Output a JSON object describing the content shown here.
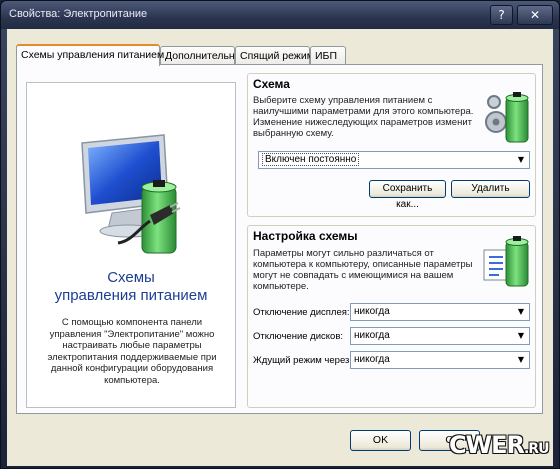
{
  "window": {
    "title": "Свойства: Электропитание",
    "help_glyph": "?",
    "close_glyph": "✕"
  },
  "tabs": [
    {
      "label": "Схемы управления питанием",
      "active": true
    },
    {
      "label": "Дополнительно",
      "active": false
    },
    {
      "label": "Спящий режим",
      "active": false
    },
    {
      "label": "ИБП",
      "active": false
    }
  ],
  "left_panel": {
    "title_line1": "Схемы",
    "title_line2": "управления питанием",
    "description": "С помощью компонента панели управления \"Электропитание\" можно настраивать любые параметры электропитания поддерживаемые при данной конфигурации оборудования компьютера."
  },
  "scheme_group": {
    "title": "Схема",
    "description": "Выберите схему управления питанием с наилучшими параметрами для этого компьютера. Изменение нижеследующих параметров изменит выбранную схему.",
    "selected_scheme": "Включен постоянно",
    "save_as_label": "Сохранить как...",
    "delete_label": "Удалить"
  },
  "settings_group": {
    "title": "Настройка схемы",
    "description": "Параметры могут сильно различаться от компьютера к компьютеру, описанные параметры могут не совпадать с имеющимися на вашем компьютере.",
    "rows": [
      {
        "label": "Отключение дисплея:",
        "value": "никогда"
      },
      {
        "label": "Отключение дисков:",
        "value": "никогда"
      },
      {
        "label": "Ждущий режим через:",
        "value": "никогда"
      }
    ]
  },
  "footer": {
    "ok_label": "OK",
    "cancel_label": "О"
  },
  "watermark": {
    "text": "CWER",
    "suffix": ".RU"
  },
  "colors": {
    "accent_title": "#1c3f94",
    "battery_green": "#3bb54a",
    "tab_highlight": "#e68b2c"
  }
}
